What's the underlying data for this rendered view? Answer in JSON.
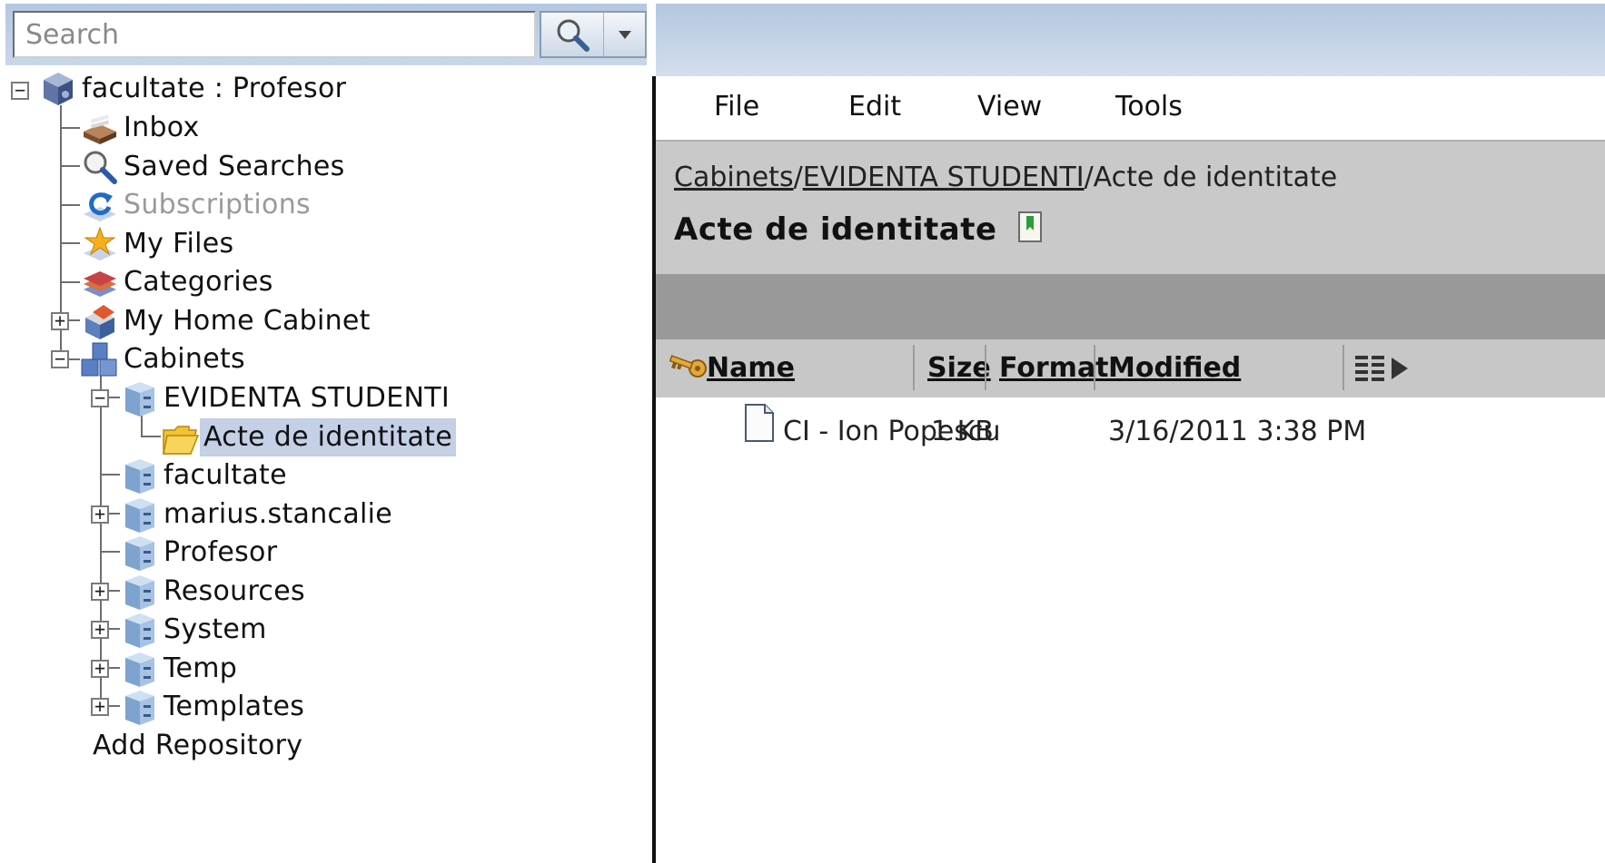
{
  "search": {
    "placeholder": "Search"
  },
  "tree": {
    "root": "facultate : Profesor",
    "items": [
      {
        "label": "Inbox"
      },
      {
        "label": "Saved Searches"
      },
      {
        "label": "Subscriptions"
      },
      {
        "label": "My Files"
      },
      {
        "label": "Categories"
      },
      {
        "label": "My Home Cabinet"
      },
      {
        "label": "Cabinets"
      }
    ],
    "cabinets": [
      {
        "label": "EVIDENTA STUDENTI"
      },
      {
        "label": "Acte de identitate"
      },
      {
        "label": "facultate"
      },
      {
        "label": "marius.stancalie"
      },
      {
        "label": "Profesor"
      },
      {
        "label": "Resources"
      },
      {
        "label": "System"
      },
      {
        "label": "Temp"
      },
      {
        "label": "Templates"
      }
    ],
    "add_repository": "Add Repository"
  },
  "menu": {
    "file": "File",
    "edit": "Edit",
    "view": "View",
    "tools": "Tools"
  },
  "breadcrumb": {
    "crumb1": "Cabinets",
    "sep": "/",
    "crumb2": "EVIDENTA STUDENTI",
    "current": "Acte de identitate"
  },
  "folder_title": "Acte de identitate",
  "columns": {
    "name": "Name",
    "size": "Size",
    "format": "Format",
    "modified": "Modified"
  },
  "files": [
    {
      "name": "CI - Ion Popescu",
      "size": "1 KB",
      "format": "",
      "modified": "3/16/2011 3:38 PM"
    }
  ],
  "colors": {
    "selection": "#c3d0e6",
    "header_gray": "#c9c9c9",
    "toolbar_gray": "#999999",
    "band_blue": "#b4c7e0"
  }
}
